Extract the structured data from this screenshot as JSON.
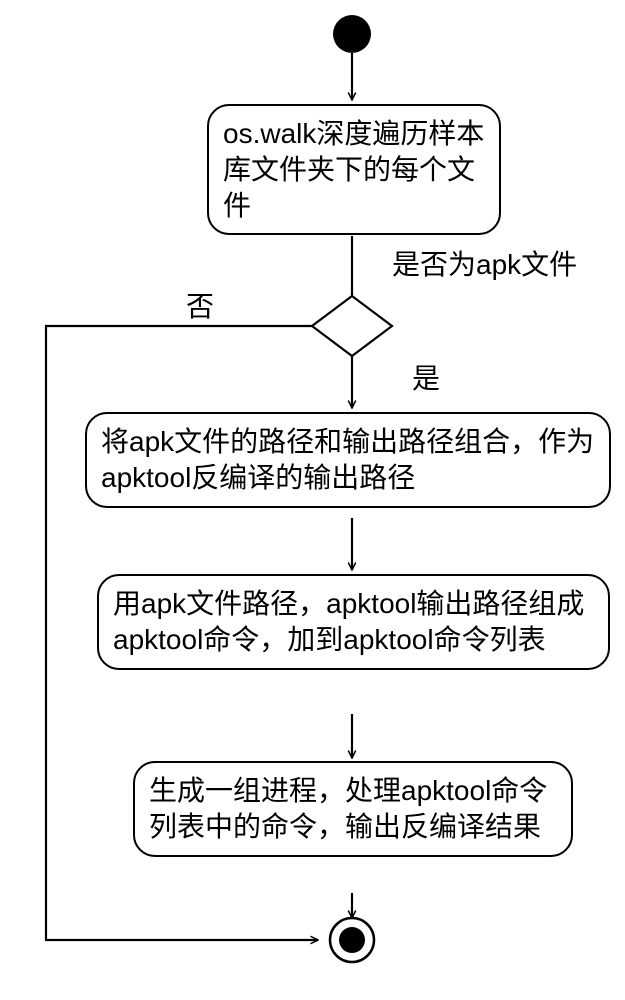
{
  "flowchart": {
    "type": "uml-activity",
    "nodes": {
      "start": {
        "kind": "initial"
      },
      "n1": {
        "text": "os.walk深度遍历样本库文件夹下的每个文件"
      },
      "decision": {
        "kind": "decision",
        "question": "是否为apk文件",
        "yes": "是",
        "no": "否"
      },
      "n2": {
        "text": "将apk文件的路径和输出路径组合，作为apktool反编译的输出路径"
      },
      "n3": {
        "text": "用apk文件路径，apktool输出路径组成apktool命令，加到apktool命令列表"
      },
      "n4": {
        "text": "生成一组进程，处理apktool命令列表中的命令，输出反编译结果"
      },
      "end": {
        "kind": "final"
      }
    },
    "edges": [
      {
        "from": "start",
        "to": "n1"
      },
      {
        "from": "n1",
        "to": "decision"
      },
      {
        "from": "decision",
        "to": "n2",
        "label": "是"
      },
      {
        "from": "decision",
        "to": "n1",
        "label": "否",
        "loop": true
      },
      {
        "from": "n2",
        "to": "n3"
      },
      {
        "from": "n3",
        "to": "n4"
      },
      {
        "from": "n4",
        "to": "end"
      },
      {
        "from": "decision-no-path",
        "to": "end"
      }
    ]
  },
  "chart_data": {
    "type": "flowchart",
    "title": "",
    "nodes": [
      {
        "id": "start",
        "type": "initial"
      },
      {
        "id": "n1",
        "type": "activity",
        "text": "os.walk深度遍历样本库文件夹下的每个文件"
      },
      {
        "id": "d1",
        "type": "decision",
        "text": "是否为apk文件"
      },
      {
        "id": "n2",
        "type": "activity",
        "text": "将apk文件的路径和输出路径组合，作为apktool反编译的输出路径"
      },
      {
        "id": "n3",
        "type": "activity",
        "text": "用apk文件路径，apktool输出路径组成apktool命令，加到apktool命令列表"
      },
      {
        "id": "n4",
        "type": "activity",
        "text": "生成一组进程，处理apktool命令列表中的命令，输出反编译结果"
      },
      {
        "id": "end",
        "type": "final"
      }
    ],
    "edges": [
      {
        "from": "start",
        "to": "n1"
      },
      {
        "from": "n1",
        "to": "d1",
        "label": ""
      },
      {
        "from": "d1",
        "to": "n2",
        "label": "是"
      },
      {
        "from": "d1",
        "to": "end",
        "label": "否"
      },
      {
        "from": "n2",
        "to": "n3"
      },
      {
        "from": "n3",
        "to": "n4"
      },
      {
        "from": "n4",
        "to": "end"
      }
    ]
  }
}
